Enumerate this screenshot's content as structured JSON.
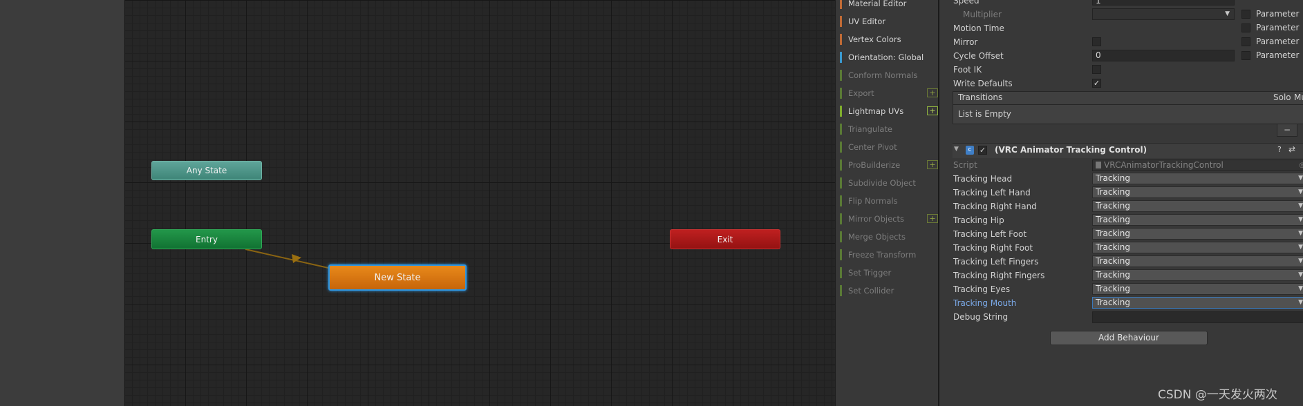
{
  "graph": {
    "nodes": {
      "any_state": "Any State",
      "entry": "Entry",
      "exit": "Exit",
      "new_state": "New State"
    }
  },
  "probuilder": {
    "items": [
      {
        "label": "Material Editor",
        "color": "#c06a35",
        "enabled": true,
        "plus": false
      },
      {
        "label": "UV Editor",
        "color": "#c06a35",
        "enabled": true,
        "plus": false
      },
      {
        "label": "Vertex Colors",
        "color": "#c06a35",
        "enabled": true,
        "plus": false
      },
      {
        "label": "Orientation: Global",
        "color": "#3a9ad0",
        "enabled": true,
        "plus": false
      },
      {
        "label": "Conform Normals",
        "color": "#5a7a35",
        "enabled": false,
        "plus": false
      },
      {
        "label": "Export",
        "color": "#5a7a35",
        "enabled": false,
        "plus": true
      },
      {
        "label": "Lightmap UVs",
        "color": "#7fae2d",
        "enabled": true,
        "plus": true
      },
      {
        "label": "Triangulate",
        "color": "#5a7a35",
        "enabled": false,
        "plus": false
      },
      {
        "label": "Center Pivot",
        "color": "#5a7a35",
        "enabled": false,
        "plus": false
      },
      {
        "label": "ProBuilderize",
        "color": "#5a7a35",
        "enabled": false,
        "plus": true
      },
      {
        "label": "Subdivide Object",
        "color": "#5a7a35",
        "enabled": false,
        "plus": false
      },
      {
        "label": "Flip Normals",
        "color": "#5a7a35",
        "enabled": false,
        "plus": false
      },
      {
        "label": "Mirror Objects",
        "color": "#5a7a35",
        "enabled": false,
        "plus": true
      },
      {
        "label": "Merge Objects",
        "color": "#5a7a35",
        "enabled": false,
        "plus": false
      },
      {
        "label": "Freeze Transform",
        "color": "#5a7a35",
        "enabled": false,
        "plus": false
      },
      {
        "label": "Set Trigger",
        "color": "#5a7a35",
        "enabled": false,
        "plus": false
      },
      {
        "label": "Set Collider",
        "color": "#5a7a35",
        "enabled": false,
        "plus": false
      }
    ],
    "plus_glyph": "+"
  },
  "inspector": {
    "speed_label": "Speed",
    "speed_value": "1",
    "multiplier_label": "Multiplier",
    "motion_time_label": "Motion Time",
    "mirror_label": "Mirror",
    "cycle_offset_label": "Cycle Offset",
    "cycle_offset_value": "0",
    "foot_ik_label": "Foot IK",
    "write_defaults_label": "Write Defaults",
    "write_defaults_checked": true,
    "parameter_label": "Parameter",
    "transitions": {
      "header": "Transitions",
      "solo": "Solo",
      "mute": "Mute",
      "empty": "List is Empty",
      "remove_glyph": "−"
    },
    "component": {
      "title": "(VRC Animator Tracking Control)",
      "script_label": "Script",
      "script_value": "VRCAnimatorTrackingControl",
      "debug_label": "Debug String",
      "tracking_rows": [
        {
          "label": "Tracking Head",
          "value": "Tracking"
        },
        {
          "label": "Tracking Left Hand",
          "value": "Tracking"
        },
        {
          "label": "Tracking Right Hand",
          "value": "Tracking"
        },
        {
          "label": "Tracking Hip",
          "value": "Tracking"
        },
        {
          "label": "Tracking Left Foot",
          "value": "Tracking"
        },
        {
          "label": "Tracking Right Foot",
          "value": "Tracking"
        },
        {
          "label": "Tracking Left Fingers",
          "value": "Tracking"
        },
        {
          "label": "Tracking Right Fingers",
          "value": "Tracking"
        },
        {
          "label": "Tracking Eyes",
          "value": "Tracking"
        },
        {
          "label": "Tracking Mouth",
          "value": "Tracking"
        }
      ]
    },
    "add_behaviour": "Add Behaviour"
  },
  "watermark": "CSDN @一天发火两次",
  "colors": {
    "accent_blue": "#3a79bb",
    "selected_label": "#7aa8e6"
  }
}
